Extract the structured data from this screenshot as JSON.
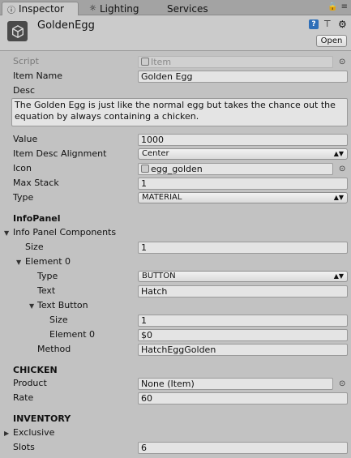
{
  "tabs": {
    "inspector": "Inspector",
    "lighting": "Lighting",
    "services": "Services"
  },
  "header": {
    "object_name": "GoldenEgg",
    "open_label": "Open"
  },
  "props": {
    "script_label": "Script",
    "script_value": "Item",
    "item_name_label": "Item Name",
    "item_name_value": "Golden Egg",
    "desc_label": "Desc",
    "desc_value": "The Golden Egg is just like the normal egg but takes the chance out the equation by always containing a chicken.",
    "value_label": "Value",
    "value_value": "1000",
    "align_label": "Item Desc Alignment",
    "align_value": "Center",
    "icon_label": "Icon",
    "icon_value": "egg_golden",
    "maxstack_label": "Max Stack",
    "maxstack_value": "1",
    "type_label": "Type",
    "type_value": "MATERIAL"
  },
  "infopanel": {
    "section": "InfoPanel",
    "components_label": "Info Panel Components",
    "size_label": "Size",
    "size_value": "1",
    "element_label": "Element 0",
    "type_label": "Type",
    "type_value": "BUTTON",
    "text_label": "Text",
    "text_value": "Hatch",
    "textbutton_label": "Text Button",
    "tb_size_label": "Size",
    "tb_size_value": "1",
    "tb_element_label": "Element 0",
    "tb_element_value": "$0",
    "method_label": "Method",
    "method_value": "HatchEggGolden"
  },
  "chicken": {
    "section": "CHICKEN",
    "product_label": "Product",
    "product_value": "None (Item)",
    "rate_label": "Rate",
    "rate_value": "60"
  },
  "inventory": {
    "section": "INVENTORY",
    "exclusive_label": "Exclusive",
    "slots_label": "Slots",
    "slots_value": "6"
  }
}
